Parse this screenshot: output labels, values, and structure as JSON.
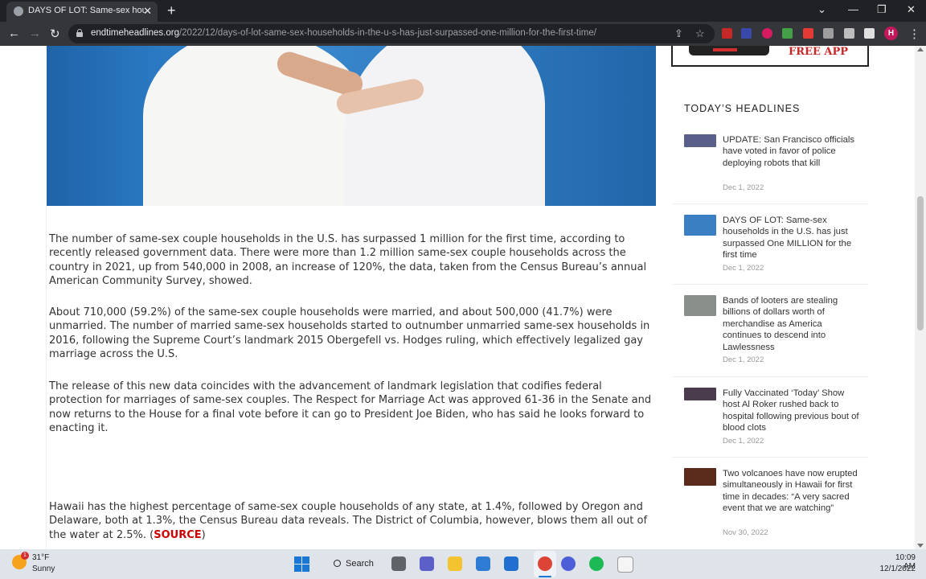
{
  "browser": {
    "tab_title": "DAYS OF LOT: Same-sex househo",
    "tab_close": "✕",
    "new_tab": "+",
    "url_host": "endtimeheadlines.org",
    "url_path": "/2022/12/days-of-lot-same-sex-households-in-the-u-s-has-just-surpassed-one-million-for-the-first-time/",
    "profile_initial": "H"
  },
  "article": {
    "paragraphs": [
      "The number of same-sex couple households in the U.S. has surpassed 1 million for the first time, according to recently released government data. There were more than 1.2 million same-sex couple households across the country in 2021, up from 540,000 in 2008, an increase of 120%, the data, taken from the Census Bureau’s annual American Community Survey, showed.",
      "About 710,000 (59.2%) of the same-sex couple households were married, and about 500,000 (41.7%) were unmarried. The number of married same-sex households started to outnumber unmarried same-sex households in 2016, following the Supreme Court’s landmark 2015 Obergefell vs. Hodges ruling, which effectively legalized gay marriage across the U.S.",
      "The release of this new data coincides with the advancement of landmark legislation that codifies federal protection for marriages of same-sex couples. The Respect for Marriage Act was approved 61-36 in the Senate and now returns to the House for a final vote before it can go to President Joe Biden, who has said he looks forward to enacting it."
    ],
    "last_paragraph": "Hawaii has the highest percentage of same-sex couple households of any state, at 1.4%, followed by Oregon and Delaware, both at 1.3%, the Census Bureau data reveals. The District of Columbia, however, blows them all out of the water at 2.5%.",
    "source_open": " (",
    "source_label": "SOURCE",
    "source_close": ")"
  },
  "sidebar": {
    "ad_text": "FREE APP",
    "headlines_title": "TODAY’S HEADLINES",
    "headlines": [
      {
        "title": "UPDATE: San Francisco officials have voted in favor of police deploying robots that kill",
        "date": "Dec 1, 2022",
        "thumb_color": "#5a5f8a"
      },
      {
        "title": "DAYS OF LOT: Same-sex households in the U.S. has just surpassed One MILLION for the first time",
        "date": "Dec 1, 2022",
        "thumb_color": "#3a7fc2"
      },
      {
        "title": "Bands of looters are stealing billions of dollars worth of merchandise as America continues to descend into Lawlessness",
        "date": "Dec 1, 2022",
        "thumb_color": "#8a8f8c"
      },
      {
        "title": "Fully Vaccinated ‘Today’ Show host Al Roker rushed back to hospital following previous bout of blood clots",
        "date": "Dec 1, 2022",
        "thumb_color": "#4a3b4d"
      },
      {
        "title": "Two volcanoes have now erupted simultaneously in Hawaii for first time in decades: “A very sacred event that we are watching”",
        "date": "Nov 30, 2022",
        "thumb_color": "#5a2a1a"
      }
    ]
  },
  "taskbar": {
    "weather_temp": "31°F",
    "weather_cond": "Sunny",
    "weather_badge": "1",
    "search_label": "Search",
    "time": "10:09 AM",
    "date": "12/1/2022"
  }
}
